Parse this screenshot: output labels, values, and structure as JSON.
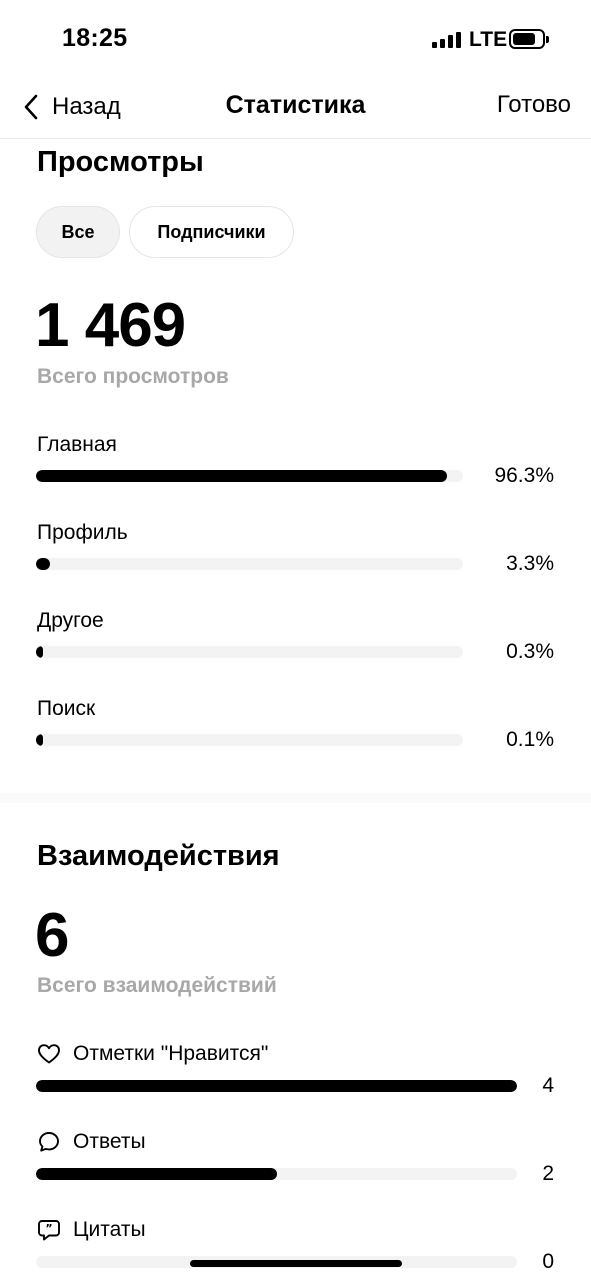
{
  "status_bar": {
    "time": "18:25",
    "network": "LTE",
    "battery_level": 0.8,
    "signal_icon": "cellular-signal-icon",
    "battery_icon": "battery-icon"
  },
  "nav": {
    "back_label": "Назад",
    "title": "Статистика",
    "done_label": "Готово",
    "back_icon": "chevron-left-icon"
  },
  "views": {
    "title": "Просмотры",
    "filters": [
      {
        "label": "Все",
        "active": true
      },
      {
        "label": "Подписчики",
        "active": false
      }
    ],
    "total": "1 469",
    "total_label": "Всего просмотров",
    "rows": [
      {
        "label": "Главная",
        "value_text": "96.3%",
        "fraction": 0.963
      },
      {
        "label": "Профиль",
        "value_text": "3.3%",
        "fraction": 0.033
      },
      {
        "label": "Другое",
        "value_text": "0.3%",
        "fraction": 0.003
      },
      {
        "label": "Поиск",
        "value_text": "0.1%",
        "fraction": 0.001
      }
    ]
  },
  "interactions": {
    "title": "Взаимодействия",
    "total": "6",
    "total_label": "Всего взаимодействий",
    "rows": [
      {
        "label": "Отметки \"Нравится\"",
        "icon": "heart-icon",
        "value_text": "4",
        "fraction": 1.0
      },
      {
        "label": "Ответы",
        "icon": "comment-bubble-icon",
        "value_text": "2",
        "fraction": 0.5
      },
      {
        "label": "Цитаты",
        "icon": "quote-bubble-icon",
        "value_text": "0",
        "fraction": 0.0
      }
    ]
  },
  "colors": {
    "bar_fill": "#000000",
    "track": "#f3f3f3",
    "muted_text": "#a8a8a8"
  }
}
